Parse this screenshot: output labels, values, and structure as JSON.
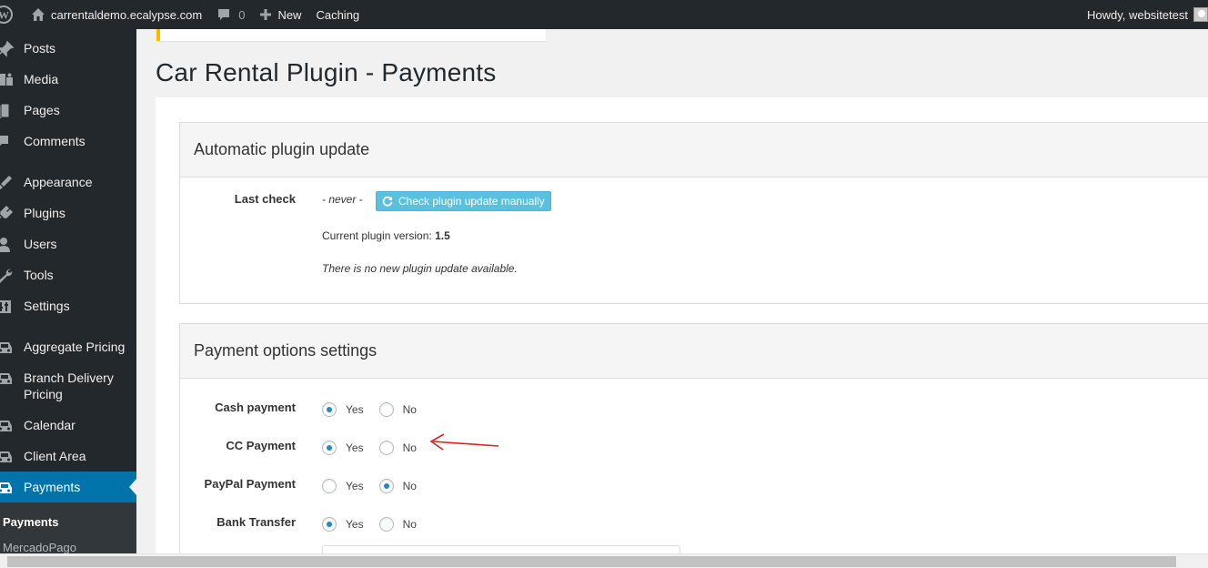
{
  "adminbar": {
    "site_name": "carrentaldemo.ecalypse.com",
    "comments_count": "0",
    "new_label": "New",
    "caching_label": "Caching",
    "howdy": "Howdy, websitetest"
  },
  "sidebar": {
    "items": [
      {
        "label": "Posts",
        "icon": "pushpin-icon"
      },
      {
        "label": "Media",
        "icon": "media-icon"
      },
      {
        "label": "Pages",
        "icon": "pages-icon"
      },
      {
        "label": "Comments",
        "icon": "comment-icon"
      },
      {
        "label": "Appearance",
        "icon": "brush-icon"
      },
      {
        "label": "Plugins",
        "icon": "plug-icon"
      },
      {
        "label": "Users",
        "icon": "user-icon"
      },
      {
        "label": "Tools",
        "icon": "wrench-icon"
      },
      {
        "label": "Settings",
        "icon": "settings-icon"
      },
      {
        "label": "Aggregate Pricing",
        "icon": "car-icon"
      },
      {
        "label": "Branch Delivery Pricing",
        "icon": "car-icon"
      },
      {
        "label": "Calendar",
        "icon": "car-icon"
      },
      {
        "label": "Client Area",
        "icon": "car-icon"
      },
      {
        "label": "Payments",
        "icon": "car-icon",
        "current": true
      }
    ],
    "submenu": [
      {
        "label": "Payments",
        "current": true
      },
      {
        "label": "MercadoPago"
      }
    ]
  },
  "page": {
    "title": "Car Rental Plugin - Payments"
  },
  "update_panel": {
    "heading": "Automatic plugin update",
    "last_check_label": "Last check",
    "last_check_value": "- never -",
    "check_button": "Check plugin update manually",
    "version_text": "Current plugin version:",
    "version_value": "1.5",
    "status_text": "There is no new plugin update available."
  },
  "payment_panel": {
    "heading": "Payment options settings",
    "yes_label": "Yes",
    "no_label": "No",
    "options": [
      {
        "label": "Cash payment",
        "selected": "Yes"
      },
      {
        "label": "CC Payment",
        "selected": "Yes"
      },
      {
        "label": "PayPal Payment",
        "selected": "No"
      },
      {
        "label": "Bank Transfer",
        "selected": "Yes"
      }
    ]
  },
  "annotation": {
    "arrow_color": "#e02020"
  },
  "colors": {
    "admin_bg": "#23282d",
    "accent": "#0073aa",
    "radio_checked": "#1e8cbe",
    "info_button": "#5bc0de",
    "notice_border": "#ffb900"
  }
}
